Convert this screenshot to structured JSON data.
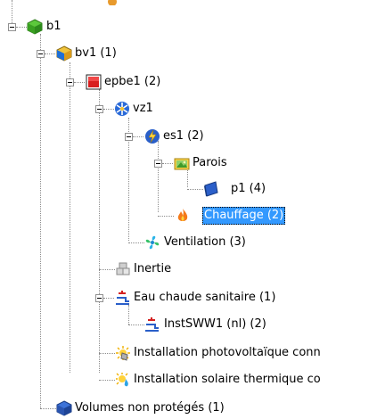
{
  "tree": {
    "nodes": [
      {
        "label": "b1",
        "icon": "green-cube-icon"
      },
      {
        "label": "bv1 (1)",
        "icon": "yellow-cube-icon"
      },
      {
        "label": "epbe1 (2)",
        "icon": "red-cube-icon"
      },
      {
        "label": "vz1",
        "icon": "snowflake-sun-icon"
      },
      {
        "label": "es1 (2)",
        "icon": "energy-sector-icon"
      },
      {
        "label": "Parois",
        "icon": "folder-landscape-icon"
      },
      {
        "label": "p1 (4)",
        "icon": "wall-panel-icon"
      },
      {
        "label": "Chauffage (2)",
        "icon": "flame-icon",
        "selected": true
      },
      {
        "label": "Ventilation (3)",
        "icon": "fan-icon"
      },
      {
        "label": "Inertie",
        "icon": "inertia-blocks-icon"
      },
      {
        "label": "Eau chaude sanitaire (1)",
        "icon": "hot-water-tap-icon"
      },
      {
        "label": "InstSWW1 (nl) (2)",
        "icon": "hot-water-tap-icon"
      },
      {
        "label": "Installation photovoltaïque conn",
        "icon": "solar-pv-icon"
      },
      {
        "label": "Installation solaire thermique co",
        "icon": "solar-thermal-icon"
      },
      {
        "label": "Volumes non protégés (1)",
        "icon": "blue-cube-icon"
      }
    ]
  },
  "colors": {
    "selection": "#3399ff",
    "connector": "#8c8c8c"
  }
}
